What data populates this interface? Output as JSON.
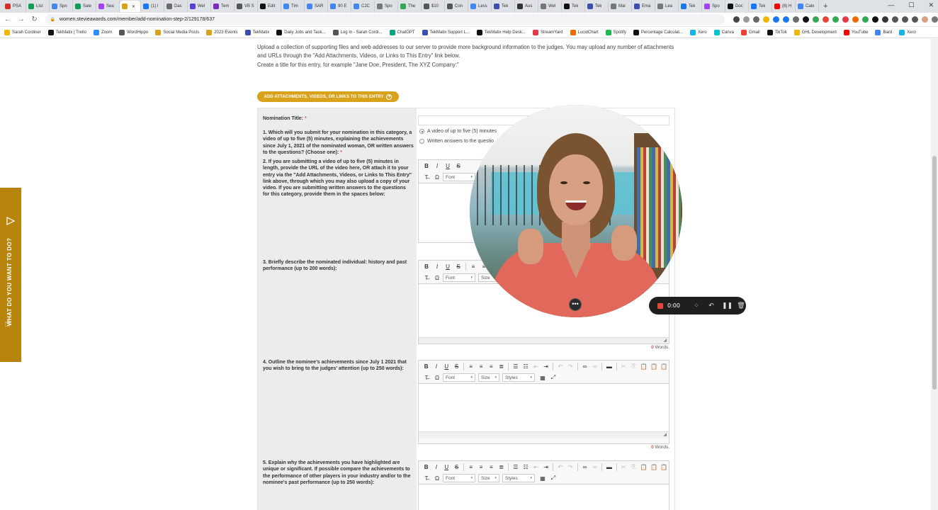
{
  "browser": {
    "tabs": [
      {
        "label": "PSA",
        "color": "#d93025"
      },
      {
        "label": "List",
        "color": "#0f9d58"
      },
      {
        "label": "Spo",
        "color": "#4285f4"
      },
      {
        "label": "Sale",
        "color": "#0f9d58"
      },
      {
        "label": "Sea",
        "color": "#a142f4"
      },
      {
        "label": "",
        "color": "#d9a21b",
        "active": true
      },
      {
        "label": "(1) l",
        "color": "#1877f2"
      },
      {
        "label": "Das",
        "color": "#6b6b6b"
      },
      {
        "label": "Wel",
        "color": "#5b3fd1"
      },
      {
        "label": "Tem",
        "color": "#7b2cbf"
      },
      {
        "label": "VB S",
        "color": "#555"
      },
      {
        "label": "Edit",
        "color": "#111"
      },
      {
        "label": "Tim",
        "color": "#4285f4"
      },
      {
        "label": "SAR",
        "color": "#4285f4"
      },
      {
        "label": "90 E",
        "color": "#4285f4"
      },
      {
        "label": "C2C",
        "color": "#4285f4"
      },
      {
        "label": "Spo",
        "color": "#777"
      },
      {
        "label": "The",
        "color": "#34a853"
      },
      {
        "label": "$10",
        "color": "#555"
      },
      {
        "label": "Con",
        "color": "#555"
      },
      {
        "label": "Less",
        "color": "#4285f4"
      },
      {
        "label": "Tek",
        "color": "#3c4fb0"
      },
      {
        "label": "Aus",
        "color": "#333"
      },
      {
        "label": "Wel",
        "color": "#777"
      },
      {
        "label": "Tek",
        "color": "#111"
      },
      {
        "label": "Tek",
        "color": "#3c4fb0"
      },
      {
        "label": "Mai",
        "color": "#777"
      },
      {
        "label": "Ema",
        "color": "#3c4fb0"
      },
      {
        "label": "Lea",
        "color": "#777"
      },
      {
        "label": "Tek",
        "color": "#1877f2"
      },
      {
        "label": "Spo",
        "color": "#a142f4"
      },
      {
        "label": "Doc",
        "color": "#111"
      },
      {
        "label": "Tek",
        "color": "#1877f2"
      },
      {
        "label": "(8) H",
        "color": "#ff0000"
      },
      {
        "label": "Calo",
        "color": "#4285f4"
      }
    ],
    "new_tab": "+",
    "url": "women.stevieawards.com/member/add-nomination-step-2/129178/637",
    "bookmarks": [
      {
        "label": "Sarah Cordiner",
        "color": "#f4b400"
      },
      {
        "label": "TekMatix | Trello",
        "color": "#111"
      },
      {
        "label": "Zoom",
        "color": "#2d8cff"
      },
      {
        "label": "WordHippo",
        "color": "#555"
      },
      {
        "label": "Social Media Posts",
        "color": "#d9a21b"
      },
      {
        "label": "2023 Events",
        "color": "#d9a21b"
      },
      {
        "label": "TekMatix",
        "color": "#3c4fb0"
      },
      {
        "label": "Daily Jobs and Task...",
        "color": "#111"
      },
      {
        "label": "Log In - Sarah Cordi...",
        "color": "#555"
      },
      {
        "label": "ChatGPT",
        "color": "#10a37f"
      },
      {
        "label": "TekMatix Support L...",
        "color": "#3c4fb0"
      },
      {
        "label": "TekMatix Help Desk...",
        "color": "#111"
      },
      {
        "label": "StreamYard",
        "color": "#e63946"
      },
      {
        "label": "LucidChart",
        "color": "#f06c00"
      },
      {
        "label": "Spotify",
        "color": "#1db954"
      },
      {
        "label": "Percentage Calculat...",
        "color": "#111"
      },
      {
        "label": "Xero",
        "color": "#13b5ea"
      },
      {
        "label": "Canva",
        "color": "#00c4cc"
      },
      {
        "label": "Gmail",
        "color": "#ea4335"
      },
      {
        "label": "TikTok",
        "color": "#111"
      },
      {
        "label": "GHL Development",
        "color": "#f4b400"
      },
      {
        "label": "YouTube",
        "color": "#ff0000"
      },
      {
        "label": "Bard",
        "color": "#4285f4"
      },
      {
        "label": "Xero",
        "color": "#13b5ea"
      }
    ]
  },
  "page": {
    "intro_line1": "Upload a collection of supporting files and web addresses to our server to provide more background information to the judges. You may upload any number of attachments",
    "intro_line2": "and URLs through the \"Add Attachments, Videos, or Links to This Entry\" link below.",
    "intro_line3": "Create a title for this entry, for example \"Jane Doe, President, The XYZ Company:\"",
    "attach_button": "ADD ATTACHMENTS, VIDEOS, OR LINKS TO THIS ENTRY",
    "form": {
      "title_label": "Nomination Title:",
      "required_mark": "*",
      "q1": "1. Which will you submit for your nomination in this category, a video of up to five (5) minutes, explaining the achievements since July 1, 2021 of the nominated woman, OR written answers to the questions? (Choose one):",
      "q1_option1": "A video of up to five (5) minutes",
      "q1_option2": "Written answers to the questio",
      "q2": "2. If you are submitting a video of up to five (5) minutes in length, provide the URL of the video here, OR attach it to your entry via the \"Add Attachments, Videos, or Links to This Entry\" link above, through which you may also upload a copy of your video. If you are submitting written answers to the questions for this category, provide them in the spaces below:",
      "q3": "3. Briefly describe the nominated individual: history and past performance (up to 200 words):",
      "q4": "4. Outline the nominee's achievements since July 1 2021 that you wish to bring to the judges' attention (up to 250 words):",
      "q5": "5. Explain why the achievements you have highlighted are unique or significant. If possible compare the achievements to the performance of other players in your industry and/or to the nominee's past performance (up to 250 words):",
      "word_count": "0",
      "word_label": "Words.",
      "font_combo": "Font",
      "size_combo": "Size",
      "styles_combo": "Styles"
    }
  },
  "sidetab": {
    "label": "WHAT DO YOU WANT TO DO?"
  },
  "recorder": {
    "time": "0:00"
  }
}
